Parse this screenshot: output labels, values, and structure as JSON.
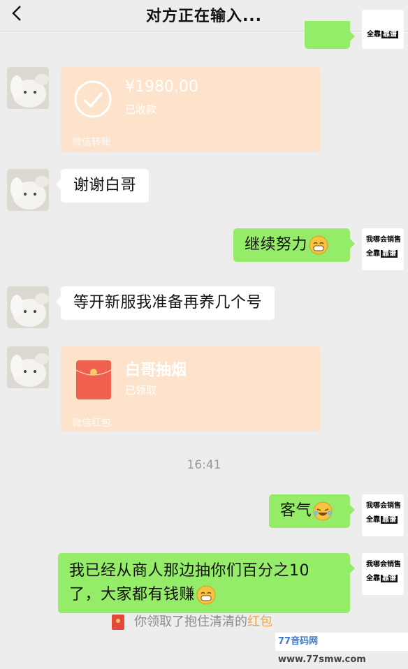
{
  "header": {
    "title": "对方正在输入..."
  },
  "my_avatar": {
    "line1": "我哪会销售",
    "line2_prefix": "全靠",
    "line2_badge": "靠谱"
  },
  "messages": {
    "top_partial": "",
    "transfer": {
      "amount": "¥1980.00",
      "status": "已收款",
      "footer": "微信转账"
    },
    "m1": "谢谢白哥",
    "m2": "继续努力",
    "m3": "等开新服我准备再养几个号",
    "red_packet": {
      "title": "白哥抽烟",
      "status": "已领取",
      "footer": "微信红包"
    },
    "time": "16:41",
    "m4": "客气",
    "m5_line1": "我已经从商人那边抽你们百分之10",
    "m5_line2": "了，大家都有钱赚"
  },
  "system": {
    "prefix": "你领取了抱住清清的",
    "highlight": "红包"
  },
  "watermark": {
    "site_a": "77音码网",
    "site_b": "www.77smw.com"
  },
  "colors": {
    "bubble_out": "#95ec69",
    "bubble_in": "#ffffff",
    "card": "#fde3cb",
    "background": "#ededed"
  }
}
